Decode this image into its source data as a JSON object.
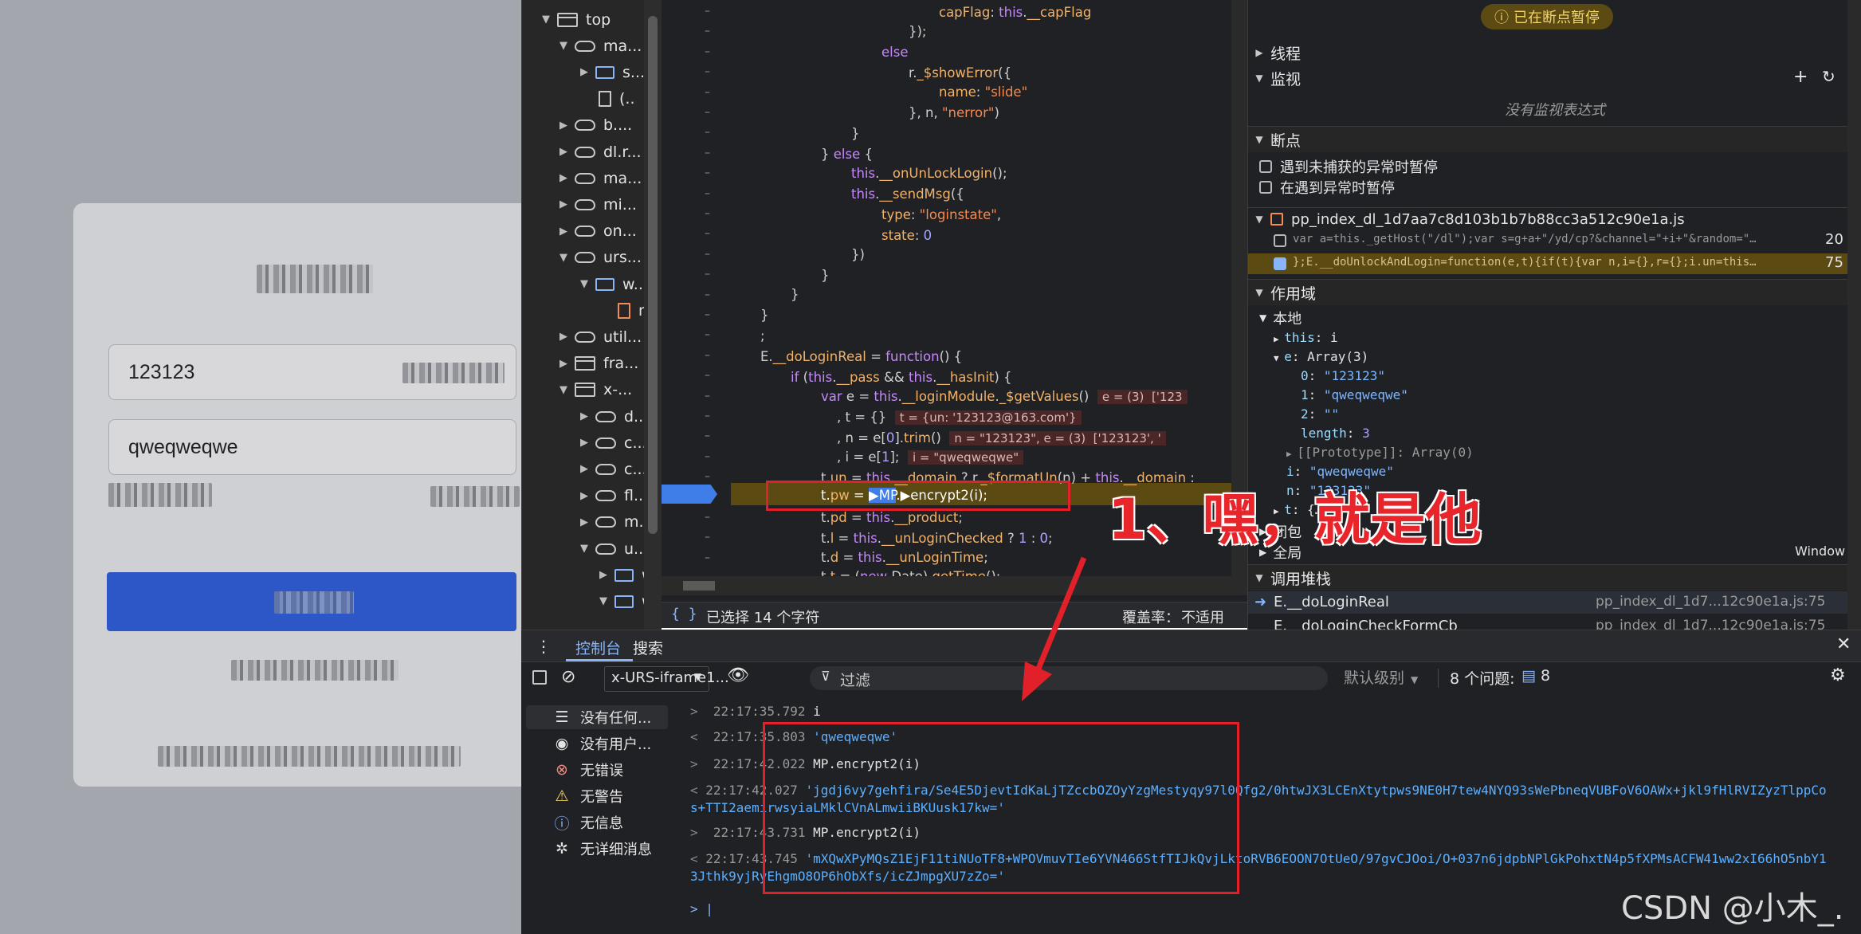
{
  "page": {
    "username_value": "123123",
    "password_value": "qweqweqwe"
  },
  "sources_tree": {
    "nodes": [
      {
        "label": "top",
        "icon": "frame-icon",
        "arrow": "▼"
      },
      {
        "label": "ma...",
        "icon": "cloud-icon",
        "arrow": "▼"
      },
      {
        "label": "s...",
        "icon": "folder-icon",
        "arrow": "▶"
      },
      {
        "label": "(..",
        "icon": "file-icon",
        "arrow": ""
      },
      {
        "label": "b....",
        "icon": "cloud-icon",
        "arrow": "▶"
      },
      {
        "label": "dl.r...",
        "icon": "cloud-icon",
        "arrow": "▶"
      },
      {
        "label": "ma...",
        "icon": "cloud-icon",
        "arrow": "▶"
      },
      {
        "label": "mi...",
        "icon": "cloud-icon",
        "arrow": "▶"
      },
      {
        "label": "on...",
        "icon": "cloud-icon",
        "arrow": "▶"
      },
      {
        "label": "urs...",
        "icon": "cloud-icon",
        "arrow": "▼"
      },
      {
        "label": "w...",
        "icon": "folder-icon",
        "arrow": "▼"
      },
      {
        "label": "n",
        "icon": "js-file-icon",
        "arrow": ""
      },
      {
        "label": "util...",
        "icon": "cloud-icon",
        "arrow": "▶"
      },
      {
        "label": "fra...",
        "icon": "frame-icon",
        "arrow": "▶"
      },
      {
        "label": "x-...",
        "icon": "frame-icon",
        "arrow": "▼"
      },
      {
        "label": "d...",
        "icon": "cloud-icon",
        "arrow": "▶"
      },
      {
        "label": "c...",
        "icon": "cloud-icon",
        "arrow": "▶"
      },
      {
        "label": "c...",
        "icon": "cloud-icon",
        "arrow": "▶"
      },
      {
        "label": "fl...",
        "icon": "cloud-icon",
        "arrow": "▶"
      },
      {
        "label": "m...",
        "icon": "cloud-icon",
        "arrow": "▶"
      },
      {
        "label": "u...",
        "icon": "cloud-icon",
        "arrow": "▼"
      },
      {
        "label": "w",
        "icon": "folder-icon",
        "arrow": "▶"
      },
      {
        "label": "w",
        "icon": "folder-icon",
        "arrow": "▼"
      }
    ]
  },
  "editor": {
    "selection_status": "已选择 14 个字符",
    "coverage_label": "覆盖率：",
    "coverage_value": "不适用"
  },
  "debugger": {
    "paused_badge": "已在断点暂停",
    "threads": "线程",
    "watch": "监视",
    "watch_empty": "没有监视表达式",
    "breakpoints": "断点",
    "pause_uncaught": "遇到未捕获的异常时暂停",
    "pause_caught": "在遇到异常时暂停",
    "bp_file": "pp_index_dl_1d7aa7c8d103b1b7b88cc3a512c90e1a.js",
    "bp1_code": "var a=this._getHost(\"/dl\");var s=g+a+\"/yd/cp?&channel=\"+i+\"&random=\"…",
    "bp1_line": "20",
    "bp2_code": "};E.__doUnlockAndLogin=function(e,t){if(t){var n,i={},r={};i.un=this…",
    "bp2_line": "75",
    "scope": "作用域",
    "local": "本地",
    "closure": "闭包",
    "global": "全局",
    "global_value": "Window",
    "call_stack": "调用堆栈",
    "stack": [
      {
        "fn": "E.__doLoginReal",
        "loc": "pp_index_dl_1d7...12c90e1a.js:75"
      },
      {
        "fn": "E.__doLoginCheckFormCb",
        "loc": "pp_index_dl_1d7...12c90e1a.js:75"
      }
    ]
  },
  "console": {
    "tab_console": "控制台",
    "tab_search": "搜索",
    "context": "x-URS-iframe1...",
    "filter_placeholder": "过滤",
    "level": "默认级别",
    "issues": "8 个问题:",
    "issues_count": "8",
    "sidebar": [
      {
        "label": "没有任何...",
        "icon": "list-icon"
      },
      {
        "label": "没有用户...",
        "icon": "user-icon"
      },
      {
        "label": "无错误",
        "icon": "error-icon"
      },
      {
        "label": "无警告",
        "icon": "warning-icon"
      },
      {
        "label": "无信息",
        "icon": "info-icon"
      },
      {
        "label": "无详细消息",
        "icon": "bug-icon"
      }
    ],
    "log": [
      {
        "dir": ">",
        "ts": "22:17:35.792",
        "text": "i",
        "kind": "cmd"
      },
      {
        "dir": "<",
        "ts": "22:17:35.803",
        "text": "'qweqweqwe'",
        "kind": "res"
      },
      {
        "dir": ">",
        "ts": "22:17:42.022",
        "text": "MP.encrypt2(i)",
        "kind": "cmd"
      },
      {
        "dir": "<",
        "ts": "22:17:42.027",
        "text": "'jgdj6vy7gehfira/Se4E5DjevtIdKaLjTZccbOZOyYzgMestyqy97l0Qfg2/0htwJX3LCEnXtytpws9NE0H7tew4NYQ93sWePbneqVUBFoV6OAWx+jkl9fHlRVIZyzTlppCos+TTI2aemirwsyiaLMklCVnALmwiiBKUusk17kw='",
        "kind": "res"
      },
      {
        "dir": ">",
        "ts": "22:17:43.731",
        "text": "MP.encrypt2(i)",
        "kind": "cmd"
      },
      {
        "dir": "<",
        "ts": "22:17:43.745",
        "text": "'mXQwXPyMQsZ1EjF11tiNUoTF8+WPOVmuvTIe6YVN466StfTIJkQvjLktoRVB6EOON7OtUeO/97gvCJOoi/O+037n6jdpbNPlGkPohxtN4p5fXPMsACFW41ww2xI66hO5nbY13Jthk9yjRyEhgmO8OP6hObXfs/icZJmpgXU7zZo='",
        "kind": "res"
      }
    ]
  },
  "annotation": {
    "text": "1、嘿，就是他"
  },
  "watermark": "CSDN @小木_.",
  "colors": {
    "accent_red": "#e1202a",
    "exec_highlight": "#5b4a12",
    "login_button": "#2d57c6"
  }
}
